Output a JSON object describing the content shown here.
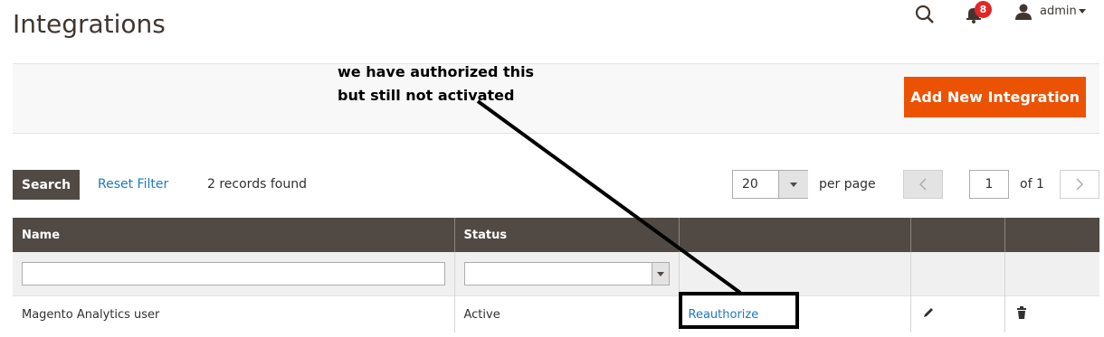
{
  "header": {
    "title": "Integrations",
    "notifications_count": "8",
    "user_label": "admin"
  },
  "action_bar": {
    "add_button_label": "Add New Integration"
  },
  "annotation": {
    "line1": "we have authorized this",
    "line2": "but still not activated"
  },
  "toolbar": {
    "search_label": "Search",
    "reset_label": "Reset Filter",
    "records_text": "2 records found",
    "per_page_value": "20",
    "per_page_label": "per page",
    "page_value": "1",
    "page_of": "of 1"
  },
  "table": {
    "columns": [
      "Name",
      "Status",
      "",
      "",
      ""
    ],
    "rows": [
      {
        "name": "Magento Analytics user",
        "status": "Active",
        "action": "Reauthorize"
      }
    ]
  },
  "icons": {
    "search": "search-icon",
    "bell": "bell-icon",
    "user": "user-icon",
    "edit": "pencil-icon",
    "delete": "trash-icon"
  },
  "colors": {
    "accent": "#eb5202",
    "header_bg": "#514943",
    "link": "#1979c3",
    "badge": "#e22626"
  }
}
